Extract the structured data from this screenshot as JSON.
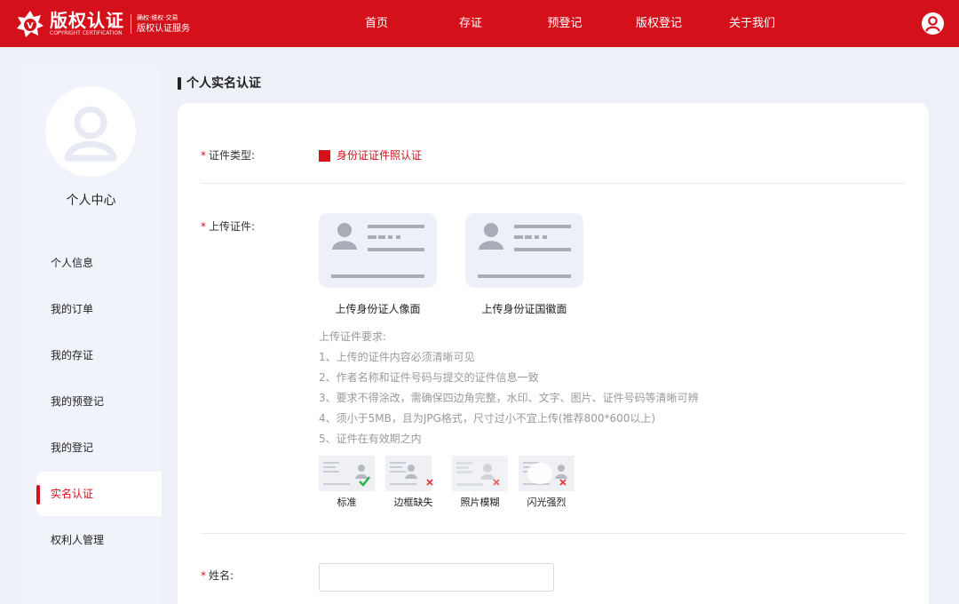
{
  "header": {
    "logo_cn": "版权认证",
    "logo_en": "COPYRIGHT CERTIFICATION",
    "logo_sub1": "确权·维权·交易",
    "logo_sub2": "版权认证服务",
    "nav": [
      "首页",
      "存证",
      "预登记",
      "版权登记",
      "关于我们"
    ],
    "user_icon": "user-circle-icon"
  },
  "sidebar": {
    "center_title": "个人中心",
    "items": [
      "个人信息",
      "我的订单",
      "我的存证",
      "我的预登记",
      "我的登记",
      "实名认证",
      "权利人管理"
    ],
    "active_index": 5
  },
  "main": {
    "title": "个人实名认证",
    "cert_type_label": "证件类型:",
    "cert_type_value": "身份证证件照认证",
    "upload_label": "上传证件:",
    "upload_front": "上传身份证人像面",
    "upload_back": "上传身份证国徽面",
    "requirements_title": "上传证件要求:",
    "requirements": [
      "1、上传的证件内容必须清晰可见",
      "2、作者名称和证件号码与提交的证件信息一致",
      "3、要求不得涂改，需确保四边角完整，水印、文字、图片、证件号码等清晰可辨",
      "4、须小于5MB，且为JPG格式，尺寸过小不宜上传(推荐800*600以上)",
      "5、证件在有效期之内"
    ],
    "examples": [
      "标准",
      "边框缺失",
      "照片模糊",
      "闪光强烈"
    ],
    "name_label": "姓名:",
    "name_value": ""
  },
  "colors": {
    "brand": "#d4111b",
    "ok": "#2bb24c"
  }
}
